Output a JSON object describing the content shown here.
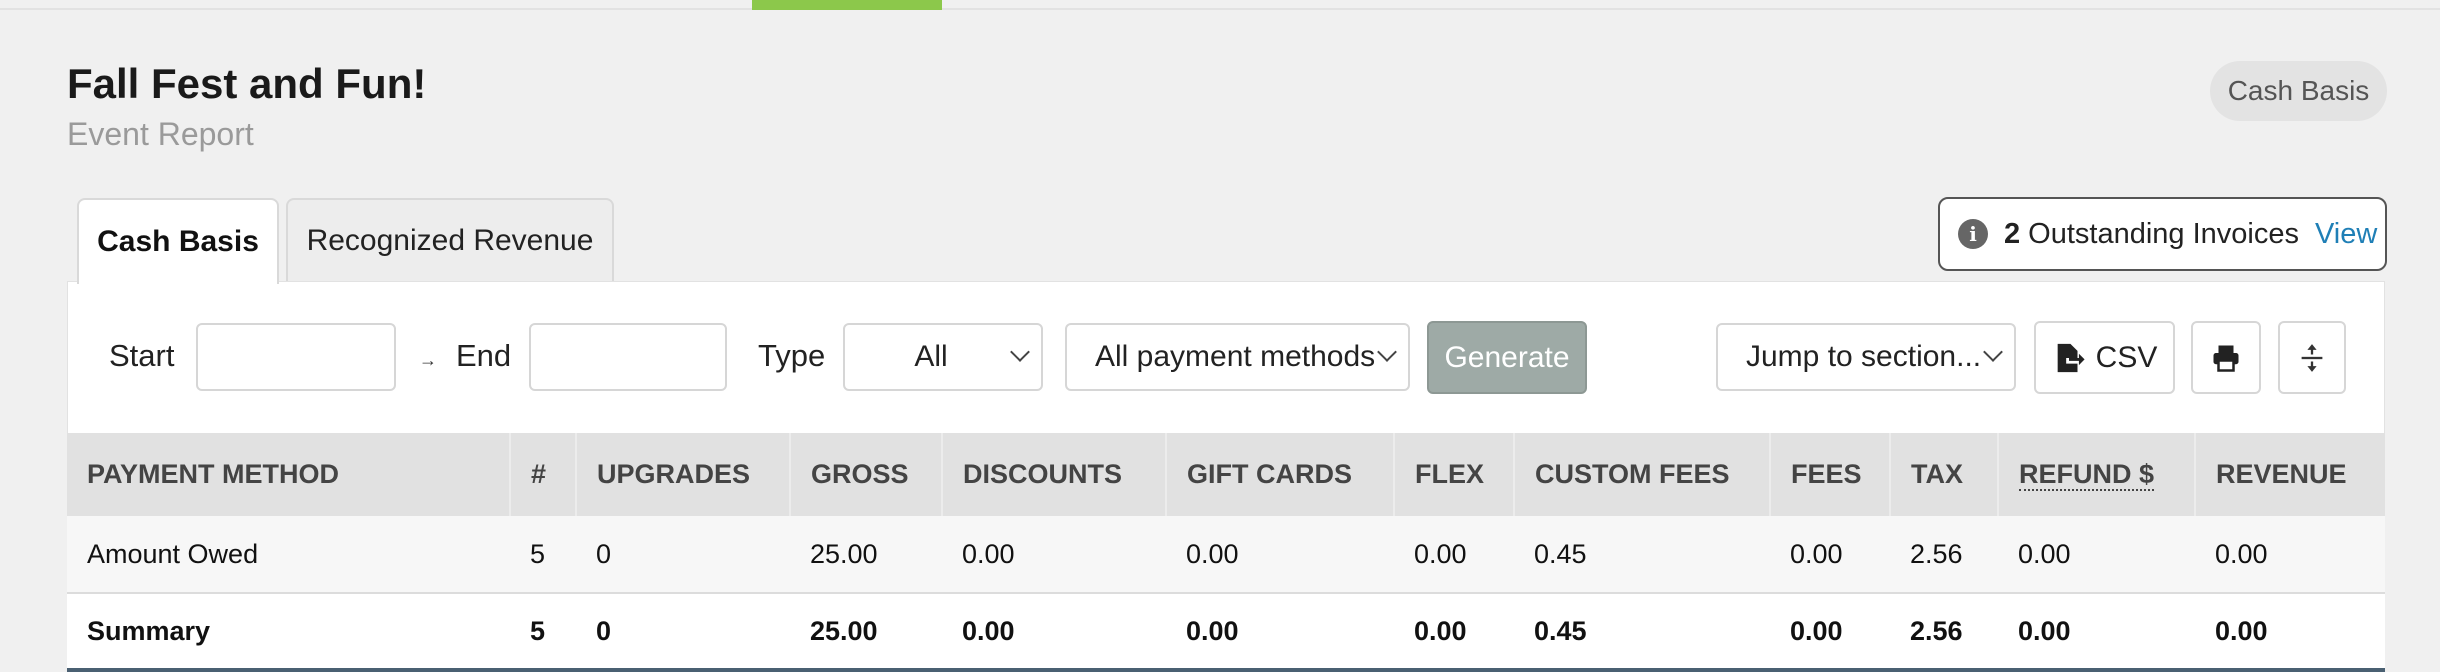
{
  "page": {
    "title": "Fall Fest and Fun!",
    "subtitle": "Event Report",
    "basis_badge": "Cash Basis"
  },
  "tabs": [
    {
      "label": "Cash Basis",
      "active": true
    },
    {
      "label": "Recognized Revenue",
      "active": false
    }
  ],
  "invoices": {
    "count": "2",
    "text": "Outstanding Invoices",
    "link": "View"
  },
  "filters": {
    "start_label": "Start",
    "start_value": "",
    "range_arrow": "→",
    "end_label": "End",
    "end_value": "",
    "type_label": "Type",
    "type_value": "All",
    "payment_value": "All payment methods",
    "generate_label": "Generate",
    "jump_value": "Jump to section...",
    "csv_label": "CSV"
  },
  "icons": {
    "info": "info-icon",
    "csv": "file-export-icon",
    "print": "printer-icon",
    "expand": "expand-vertical-icon"
  },
  "colors": {
    "tab_accent": "#8cc84b",
    "link": "#1f7fb6",
    "generate_disabled": "#9eaaa6"
  },
  "table": {
    "headers": [
      "PAYMENT METHOD",
      "#",
      "UPGRADES",
      "GROSS",
      "DISCOUNTS",
      "GIFT CARDS",
      "FLEX",
      "CUSTOM FEES",
      "FEES",
      "TAX",
      "REFUND $",
      "REVENUE"
    ],
    "rows": [
      [
        "Amount Owed",
        "5",
        "0",
        "25.00",
        "0.00",
        "0.00",
        "0.00",
        "0.45",
        "0.00",
        "2.56",
        "0.00",
        "0.00"
      ]
    ],
    "summary": [
      "Summary",
      "5",
      "0",
      "25.00",
      "0.00",
      "0.00",
      "0.00",
      "0.45",
      "0.00",
      "2.56",
      "0.00",
      "0.00"
    ]
  }
}
